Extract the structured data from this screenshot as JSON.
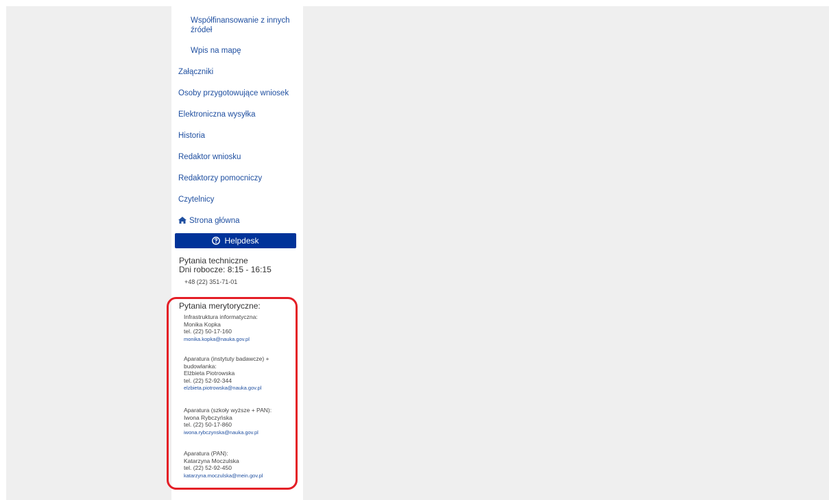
{
  "nav": {
    "sub_items": [
      {
        "label": "Współfinansowanie z innych źródeł"
      },
      {
        "label": "Wpis na mapę"
      }
    ],
    "items": [
      {
        "label": "Załączniki"
      },
      {
        "label": "Osoby przygotowujące wniosek"
      },
      {
        "label": "Elektroniczna wysyłka"
      },
      {
        "label": "Historia"
      },
      {
        "label": "Redaktor wniosku"
      },
      {
        "label": "Redaktorzy pomocniczy"
      },
      {
        "label": "Czytelnicy"
      }
    ],
    "home": {
      "label": "Strona główna",
      "icon": "home-icon"
    }
  },
  "helpdesk": {
    "label": "Helpdesk",
    "icon": "question-circle-icon",
    "color": "#003399"
  },
  "tech_support": {
    "title": "Pytania techniczne",
    "hours": "Dni robocze: 8:15 - 16:15",
    "phone": "+48 (22) 351-71-01"
  },
  "merit": {
    "title": "Pytania merytoryczne:",
    "highlight_color": "#e41e26",
    "contacts": [
      {
        "area": "Infrastruktura informatyczna:",
        "name": "Monika Kopka",
        "phone": "tel. (22) 50-17-160",
        "email": "monika.kopka@nauka.gov.pl"
      },
      {
        "area": "Aparatura (instytuty badawcze) + budowlanka:",
        "name": "Elżbieta Piotrowska",
        "phone": "tel. (22) 52-92-344",
        "email": "elzbieta.piotrowska@nauka.gov.pl"
      },
      {
        "area": "Aparatura (szkoły wyższe + PAN):",
        "name": "Iwona Rybczyńska",
        "phone": "tel. (22) 50-17-860",
        "email": "iwona.rybczynska@nauka.gov.pl"
      },
      {
        "area": "Aparatura (PAN):",
        "name": "Katarzyna Moczulska",
        "phone": "tel. (22) 52-92-450",
        "email": "katarzyna.moczulska@mein.gov.pl"
      }
    ]
  }
}
